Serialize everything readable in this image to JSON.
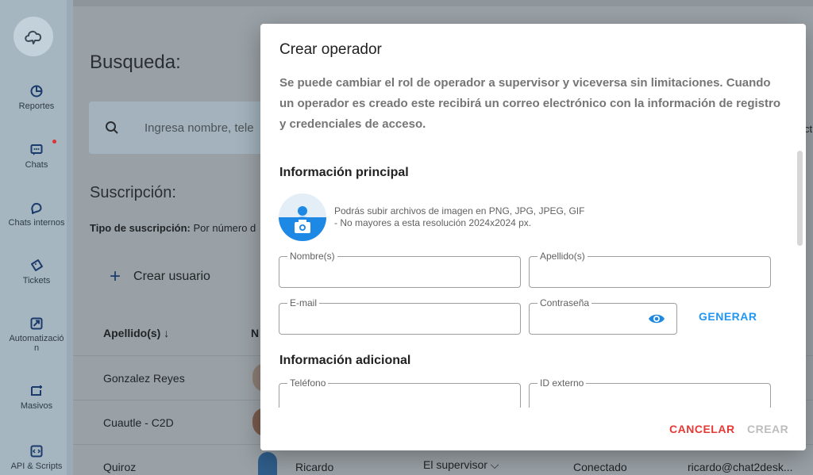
{
  "sidebar": {
    "items": [
      {
        "label": "Reportes",
        "icon": "pie-chart-icon"
      },
      {
        "label": "Chats",
        "icon": "chat-bubble-icon"
      },
      {
        "label": "Chats internos",
        "icon": "internal-chat-icon"
      },
      {
        "label": "Tickets",
        "icon": "ticket-icon"
      },
      {
        "label": "Automatizació n",
        "icon": "automation-icon"
      },
      {
        "label": "Masivos",
        "icon": "broadcast-icon"
      },
      {
        "label": "API & Scripts",
        "icon": "code-icon"
      }
    ]
  },
  "background": {
    "title": "Busqueda:",
    "search_placeholder": "Ingresa nombre, tele",
    "subscription_title": "Suscripción:",
    "subscription_type_label": "Tipo de suscripción:",
    "subscription_type_value": "Por número d",
    "create_user": "Crear usuario",
    "column_lastname": "Apellido(s) ↓",
    "column_name": "N",
    "rows": [
      "Gonzalez Reyes",
      "Cuautle - C2D",
      "Quiroz"
    ],
    "last_row": {
      "name": "Ricardo",
      "role": "El supervisor ⌵",
      "status": "Conectado",
      "email": "ricardo@chat2desk..."
    },
    "right_fragment": "ct"
  },
  "modal": {
    "title": "Crear operador",
    "description": "Se puede cambiar el rol de operador a supervisor y viceversa sin limitaciones. Cuando un operador es creado este recibirá un correo electrónico con la información de registro y credenciales de acceso.",
    "section_main": "Información principal",
    "upload_hint_line1": "Podrás subir archivos de imagen en PNG, JPG, JPEG, GIF",
    "upload_hint_line2": "- No mayores a esta resolución 2024x2024 px.",
    "fields": {
      "first_name": {
        "label": "Nombre(s)",
        "value": ""
      },
      "last_name": {
        "label": "Apellido(s)",
        "value": ""
      },
      "email": {
        "label": "E-mail",
        "value": ""
      },
      "password": {
        "label": "Contraseña",
        "value": ""
      },
      "phone": {
        "label": "Teléfono",
        "value": ""
      },
      "external_id": {
        "label": "ID externo",
        "value": ""
      }
    },
    "generate_label": "GENERAR",
    "section_additional": "Información adicional",
    "cancel_label": "CANCELAR",
    "create_label": "CREAR"
  },
  "colors": {
    "primary": "#1e88e5",
    "link": "#2196f3",
    "danger": "#e53935",
    "disabled": "#bdbdbd"
  }
}
